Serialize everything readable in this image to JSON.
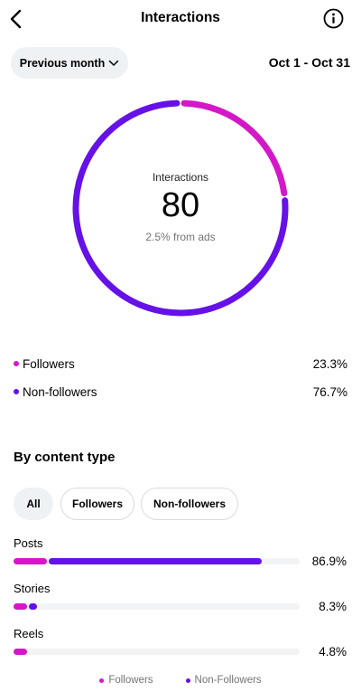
{
  "header": {
    "title": "Interactions"
  },
  "filter": {
    "period_label": "Previous month",
    "date_range": "Oct 1 - Oct 31"
  },
  "colors": {
    "followers": "#d418c8",
    "non_followers": "#6511e8",
    "track": "#f2f3f5"
  },
  "summary": {
    "label": "Interactions",
    "value": "80",
    "ads_note": "2.5% from ads",
    "followers_fraction": 0.233,
    "non_followers_fraction": 0.767
  },
  "legend": [
    {
      "label": "Followers",
      "pct": "23.3%"
    },
    {
      "label": "Non-followers",
      "pct": "76.7%"
    }
  ],
  "content_type": {
    "title": "By content type",
    "tabs": [
      "All",
      "Followers",
      "Non-followers"
    ],
    "rows": [
      {
        "label": "Posts",
        "pct": "86.9%",
        "followers": 0.12,
        "non_followers": 0.749
      },
      {
        "label": "Stories",
        "pct": "8.3%",
        "followers": 0.05,
        "non_followers": 0.033
      },
      {
        "label": "Reels",
        "pct": "4.8%",
        "followers": 0.048,
        "non_followers": 0
      }
    ],
    "legend": [
      "Followers",
      "Non-Followers"
    ]
  }
}
